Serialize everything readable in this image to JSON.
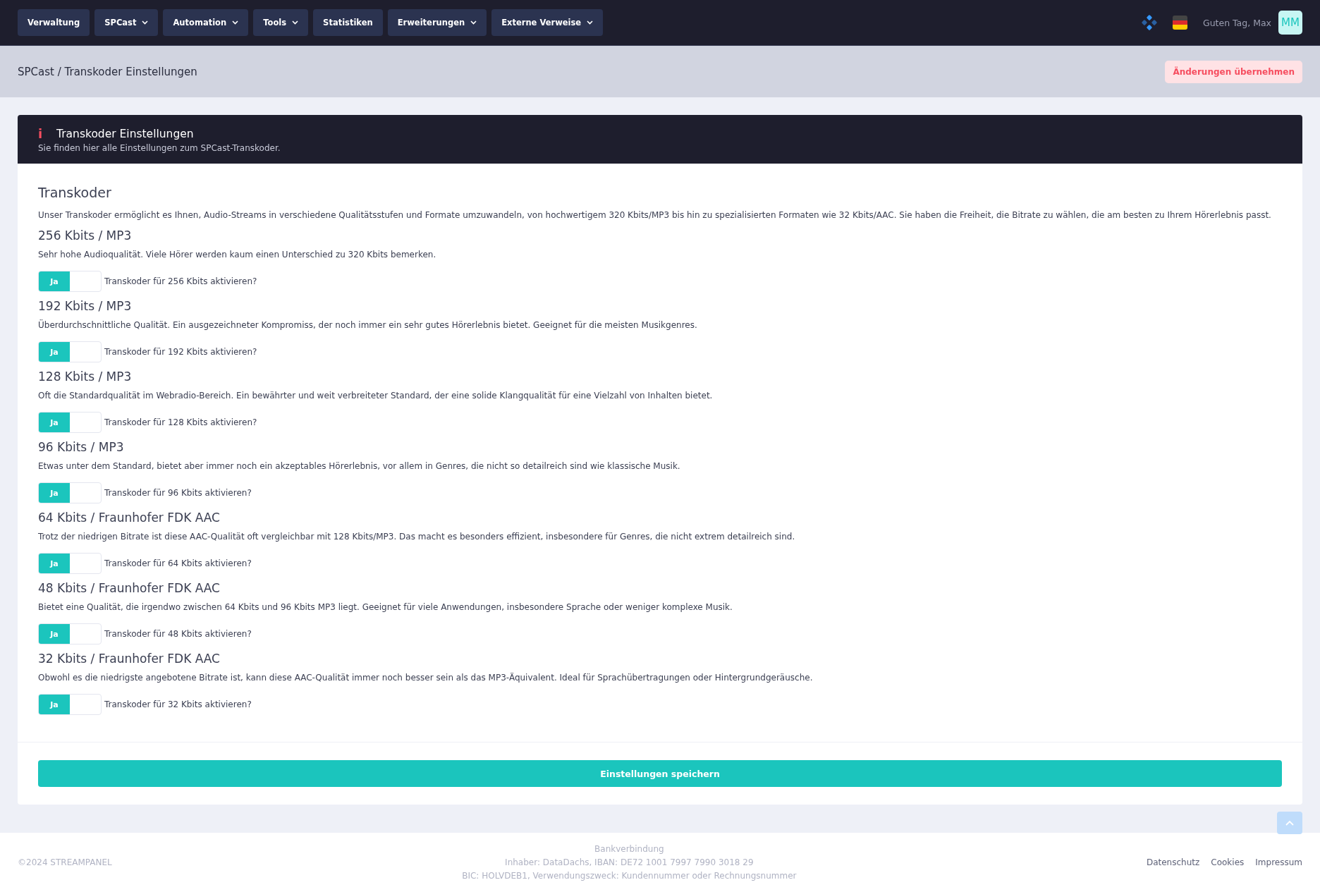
{
  "nav": {
    "items": [
      {
        "label": "Verwaltung",
        "dropdown": false
      },
      {
        "label": "SPCast",
        "dropdown": true
      },
      {
        "label": "Automation",
        "dropdown": true
      },
      {
        "label": "Tools",
        "dropdown": true
      },
      {
        "label": "Statistiken",
        "dropdown": false
      },
      {
        "label": "Erweiterungen",
        "dropdown": true
      },
      {
        "label": "Externe Verweise",
        "dropdown": true
      }
    ],
    "greeting": "Guten Tag, Max",
    "avatar": "MM"
  },
  "breadcrumb": {
    "title": "SPCast / Transkoder Einstellungen",
    "action": "Änderungen übernehmen"
  },
  "card": {
    "header_icon": "i",
    "title": "Transkoder Einstellungen",
    "subtitle": "Sie finden hier alle Einstellungen zum SPCast-Transkoder.",
    "section_title": "Transkoder",
    "intro": "Unser Transkoder ermöglicht es Ihnen, Audio-Streams in verschiedene Qualitätsstufen und Formate umzuwandeln, von hochwertigem 320 Kbits/MP3 bis hin zu spezialisierten Formaten wie 32 Kbits/AAC. Sie haben die Freiheit, die Bitrate zu wählen, die am besten zu Ihrem Hörerlebnis passt.",
    "options": [
      {
        "title": "256 Kbits / MP3",
        "description": "Sehr hohe Audioqualität. Viele Hörer werden kaum einen Unterschied zu 320 Kbits bemerken.",
        "switch_label": "Ja",
        "on": true,
        "question": "Transkoder für 256 Kbits aktivieren?"
      },
      {
        "title": "192 Kbits / MP3",
        "description": "Überdurchschnittliche Qualität. Ein ausgezeichneter Kompromiss, der noch immer ein sehr gutes Hörerlebnis bietet. Geeignet für die meisten Musikgenres.",
        "switch_label": "Ja",
        "on": true,
        "question": "Transkoder für 192 Kbits aktivieren?"
      },
      {
        "title": "128 Kbits / MP3",
        "description": "Oft die Standardqualität im Webradio-Bereich. Ein bewährter und weit verbreiteter Standard, der eine solide Klangqualität für eine Vielzahl von Inhalten bietet.",
        "switch_label": "Ja",
        "on": true,
        "question": "Transkoder für 128 Kbits aktivieren?"
      },
      {
        "title": "96 Kbits / MP3",
        "description": "Etwas unter dem Standard, bietet aber immer noch ein akzeptables Hörerlebnis, vor allem in Genres, die nicht so detailreich sind wie klassische Musik.",
        "switch_label": "Ja",
        "on": true,
        "question": "Transkoder für 96 Kbits aktivieren?"
      },
      {
        "title": "64 Kbits / Fraunhofer FDK AAC",
        "description": "Trotz der niedrigen Bitrate ist diese AAC-Qualität oft vergleichbar mit 128 Kbits/MP3. Das macht es besonders effizient, insbesondere für Genres, die nicht extrem detailreich sind.",
        "switch_label": "Ja",
        "on": true,
        "question": "Transkoder für 64 Kbits aktivieren?"
      },
      {
        "title": "48 Kbits / Fraunhofer FDK AAC",
        "description": "Bietet eine Qualität, die irgendwo zwischen 64 Kbits und 96 Kbits MP3 liegt. Geeignet für viele Anwendungen, insbesondere Sprache oder weniger komplexe Musik.",
        "switch_label": "Ja",
        "on": true,
        "question": "Transkoder für 48 Kbits aktivieren?"
      },
      {
        "title": "32 Kbits / Fraunhofer FDK AAC",
        "description": "Obwohl es die niedrigste angebotene Bitrate ist, kann diese AAC-Qualität immer noch besser sein als das MP3-Äquivalent. Ideal für Sprachübertragungen oder Hintergrundgeräusche.",
        "switch_label": "Ja",
        "on": true,
        "question": "Transkoder für 32 Kbits aktivieren?"
      }
    ],
    "save": "Einstellungen speichern"
  },
  "footer": {
    "copyright": "©2024 STREAMPANEL",
    "bank_lines": [
      "Bankverbindung",
      "Inhaber: DataDachs, IBAN: DE72 1001 7997 7990 3018 29",
      "BIC: HOLVDEB1, Verwendungszweck: Kundennummer oder Rechnungsnummer"
    ],
    "links": [
      "Datenschutz",
      "Cookies",
      "Impressum"
    ]
  }
}
